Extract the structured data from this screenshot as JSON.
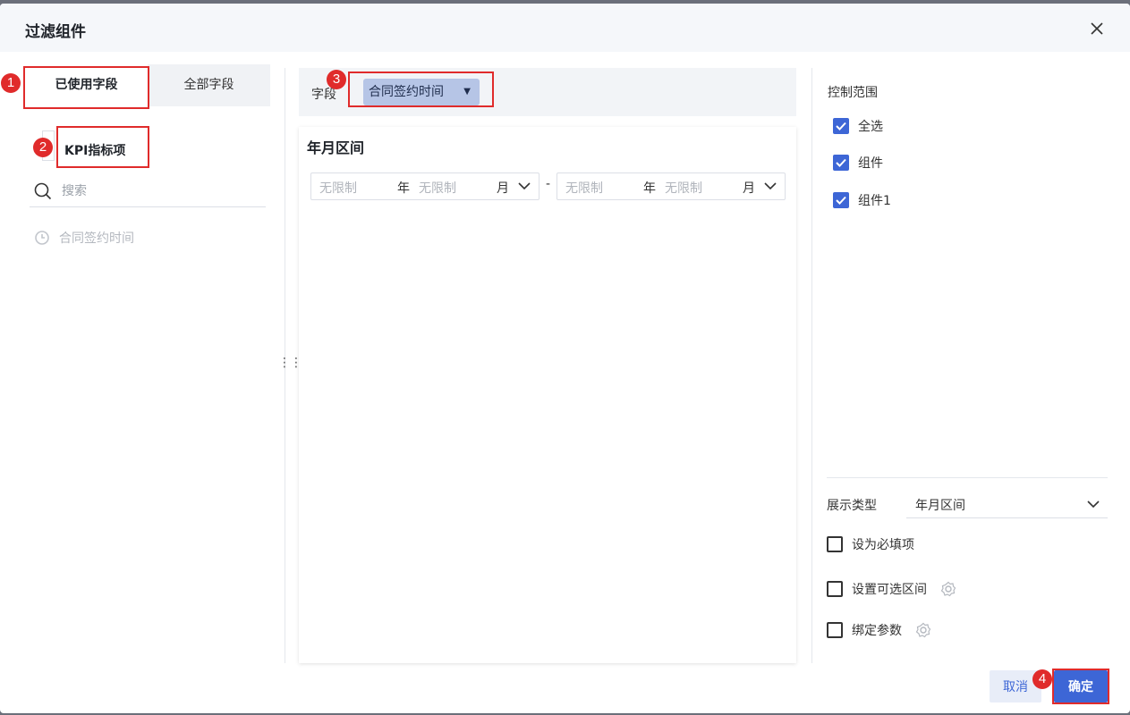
{
  "dialog": {
    "title": "过滤组件",
    "close_icon": "close-icon"
  },
  "left": {
    "tabs": [
      {
        "label": "已使用字段",
        "active": true
      },
      {
        "label": "全部字段",
        "active": false
      }
    ],
    "selected_item": "KPI指标项",
    "search_placeholder": "搜索",
    "fields": [
      {
        "label": "合同签约时间",
        "icon": "clock-icon"
      }
    ]
  },
  "middle": {
    "field_label": "字段",
    "field_chip": "合同签约时间",
    "preview": {
      "title": "年月区间",
      "start": {
        "year_placeholder": "无限制",
        "year_unit": "年",
        "month_placeholder": "无限制",
        "month_unit": "月"
      },
      "separator": "-",
      "end": {
        "year_placeholder": "无限制",
        "year_unit": "年",
        "month_placeholder": "无限制",
        "month_unit": "月"
      }
    }
  },
  "right": {
    "control_label": "控制范围",
    "scope": [
      {
        "label": "全选",
        "checked": true
      },
      {
        "label": "组件",
        "checked": true
      },
      {
        "label": "组件1",
        "checked": true
      }
    ],
    "display_type_label": "展示类型",
    "display_type_value": "年月区间",
    "options": [
      {
        "label": "设为必填项",
        "checked": false,
        "gear": false
      },
      {
        "label": "设置可选区间",
        "checked": false,
        "gear": true
      },
      {
        "label": "绑定参数",
        "checked": false,
        "gear": true
      }
    ]
  },
  "footer": {
    "cancel_label": "取消",
    "ok_label": "确定"
  },
  "annotations": [
    "1",
    "2",
    "3",
    "4"
  ],
  "colors": {
    "accent": "#3d66d6",
    "annotation": "#e02b2b",
    "chip": "#b6c5e6"
  }
}
